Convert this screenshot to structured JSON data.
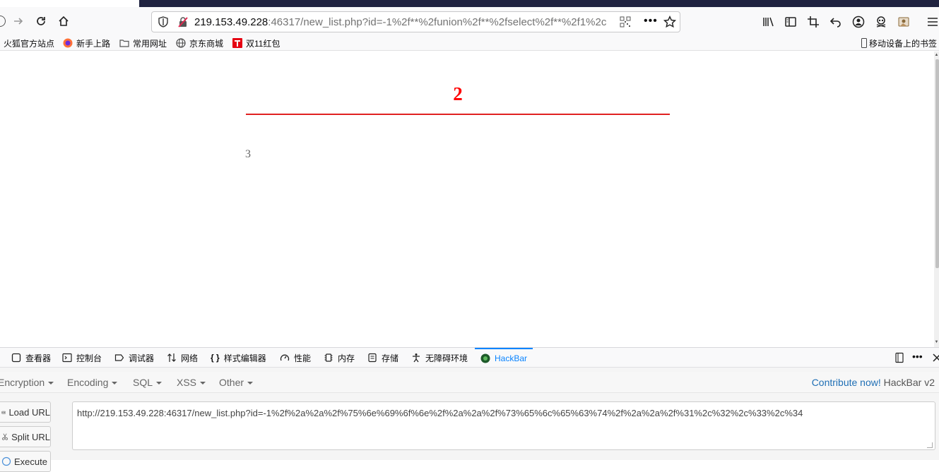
{
  "browser": {
    "url_host": "219.153.49.228",
    "url_rest": ":46317/new_list.php?id=-1%2f**%2funion%2f**%2fselect%2f**%2f1%2c"
  },
  "bookmarks": [
    {
      "label": "火狐官方站点",
      "icon": "firefox-icon"
    },
    {
      "label": "新手上路",
      "icon": "firefox-icon"
    },
    {
      "label": "常用网址",
      "icon": "folder-icon"
    },
    {
      "label": "京东商城",
      "icon": "globe-icon"
    },
    {
      "label": "双11红包",
      "icon": "tmall-icon"
    }
  ],
  "mobile_bookmarks": "移动设备上的书签",
  "page": {
    "heading": "2",
    "body": "3"
  },
  "devtools": {
    "tabs": [
      "查看器",
      "控制台",
      "调试器",
      "网络",
      "样式编辑器",
      "性能",
      "内存",
      "存储",
      "无障碍环境",
      "HackBar"
    ],
    "active_tab": "HackBar"
  },
  "hackbar": {
    "menus": [
      "Encryption",
      "Encoding",
      "SQL",
      "XSS",
      "Other"
    ],
    "contribute_link": "Contribute now!",
    "version": "HackBar v2",
    "buttons": [
      "Load URL",
      "Split URL",
      "Execute"
    ],
    "url_value": "http://219.153.49.228:46317/new_list.php?id=-1%2f%2a%2a%2f%75%6e%69%6f%6e%2f%2a%2a%2f%73%65%6c%65%63%74%2f%2a%2a%2f%31%2c%32%2c%33%2c%34"
  },
  "colors": {
    "heading": "#ff0000",
    "rule": "#e02020",
    "active_tab": "#0a84ff",
    "contribute": "#1f6fb5"
  }
}
